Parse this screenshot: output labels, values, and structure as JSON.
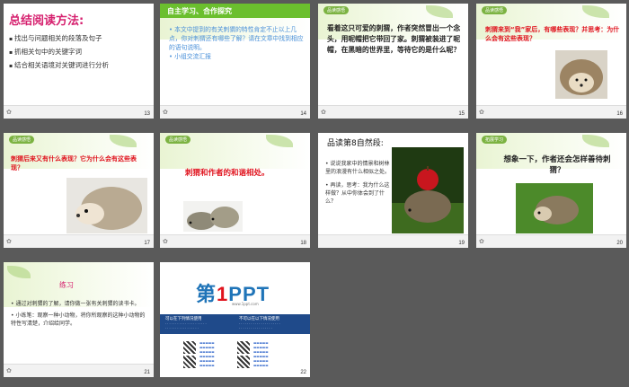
{
  "slides": {
    "s13": {
      "number": "13",
      "title": "总结阅读方法:",
      "items": [
        "找出与问题相关的段落及句子",
        "抓相关句中的关键字词",
        "结合相关语境对关键词进行分析"
      ]
    },
    "s14": {
      "number": "14",
      "title": "自主学习、合作探究",
      "items": [
        "本文中提到的有关刺猬的特性肯定不止以上几点，你对刺猬还有哪些了解？请在文章中找到相应的语句说明。",
        "小组交流汇报"
      ]
    },
    "s15": {
      "number": "15",
      "tag": "品读感悟",
      "text": "看着这只可爱的刺猬，作者突然冒出一个念头，用呢帽把它带回了家。刺猬被装进了呢帽，在黑暗的世界里，等待它的是什么呢？"
    },
    "s16": {
      "number": "16",
      "tag": "品读感悟",
      "text": "刺猬来到“我”家后，有哪些表现？并思考：为什么会有这些表现？"
    },
    "s17": {
      "number": "17",
      "tag": "品读感悟",
      "text": "刺猬后来又有什么表现？它为什么会有这些表现？"
    },
    "s18": {
      "number": "18",
      "tag": "品读感悟",
      "text": "刺猬和作者的和谐相处。"
    },
    "s19": {
      "number": "19",
      "title": "品读第8自然段:",
      "items": [
        "说说我家中的情景和树林里的浪漫有什么相似之处。",
        "再读，思考：我为什么这样做？从中你体会到了什么？"
      ]
    },
    "s20": {
      "number": "20",
      "tag": "拓展学习",
      "text": "想象一下，作者还会怎样善待刺猬？"
    },
    "s21": {
      "number": "21",
      "title": "练习",
      "items": [
        "通过对刺猬的了解，请你做一张有关刺猬的读书卡。",
        "小练笔：观察一种小动物，将你所观察的这种小动物的特性写清楚，介绍给同学。"
      ]
    },
    "s22": {
      "number": "22",
      "logo_part1": "第",
      "logo_part2": "1",
      "logo_part3": "PPT",
      "url": "www.1ppt.com",
      "left_head": "可以在下列情况使用",
      "right_head": "不可以在以下情况使用"
    }
  },
  "colors": {
    "accent": "#d6216f",
    "green": "#6bbf2e",
    "red": "#e0141e",
    "blue": "#4a90d9"
  }
}
